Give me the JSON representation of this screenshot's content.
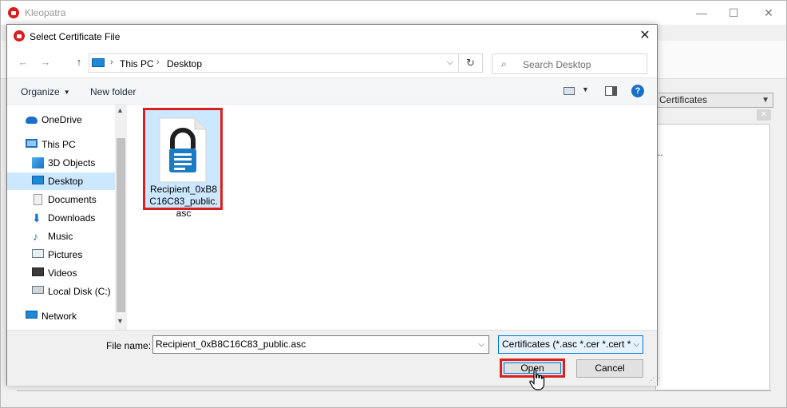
{
  "background_window": {
    "title": "Kleopatra",
    "filter_label": "Certificates",
    "list_overflow": "..",
    "window_buttons": {
      "minimize": "—",
      "maximize": "☐",
      "close": "✕"
    }
  },
  "dialog": {
    "title": "Select Certificate File",
    "close_glyph": "✕",
    "navigation": {
      "back_glyph": "←",
      "forward_glyph": "→",
      "up_glyph": "↑",
      "refresh_glyph": "↻",
      "address": {
        "root": "This PC",
        "current": "Desktop",
        "separator": "›",
        "dropdown_glyph": "⌵"
      },
      "search_placeholder": "Search Desktop"
    },
    "command_bar": {
      "organize_label": "Organize",
      "new_folder_label": "New folder",
      "help_glyph": "?"
    },
    "nav_pane": {
      "items": [
        {
          "label": "OneDrive",
          "icon": "onedrive-icon"
        },
        {
          "label": "This PC",
          "icon": "this-pc-icon"
        },
        {
          "label": "3D Objects",
          "icon": "3d-objects-icon"
        },
        {
          "label": "Desktop",
          "icon": "desktop-icon",
          "selected": true
        },
        {
          "label": "Documents",
          "icon": "documents-icon"
        },
        {
          "label": "Downloads",
          "icon": "downloads-icon"
        },
        {
          "label": "Music",
          "icon": "music-icon"
        },
        {
          "label": "Pictures",
          "icon": "pictures-icon"
        },
        {
          "label": "Videos",
          "icon": "videos-icon"
        },
        {
          "label": "Local Disk (C:)",
          "icon": "local-disk-icon"
        },
        {
          "label": "Network",
          "icon": "network-icon"
        }
      ]
    },
    "files": [
      {
        "name": "Recipient_0xB8C16C83_public.asc",
        "icon": "certificate-file-icon",
        "selected": true,
        "highlighted": true
      }
    ],
    "bottom": {
      "file_name_label": "File name:",
      "file_name_value": "Recipient_0xB8C16C83_public.asc",
      "filter_value": "Certificates (*.asc *.cer *.cert *.c",
      "open_label": "Open",
      "cancel_label": "Cancel"
    }
  },
  "colors": {
    "accent_blue": "#0078d7",
    "selection_bg": "#cce8ff",
    "highlight_red": "#d92121",
    "kleopatra_red": "#d81e1e"
  }
}
